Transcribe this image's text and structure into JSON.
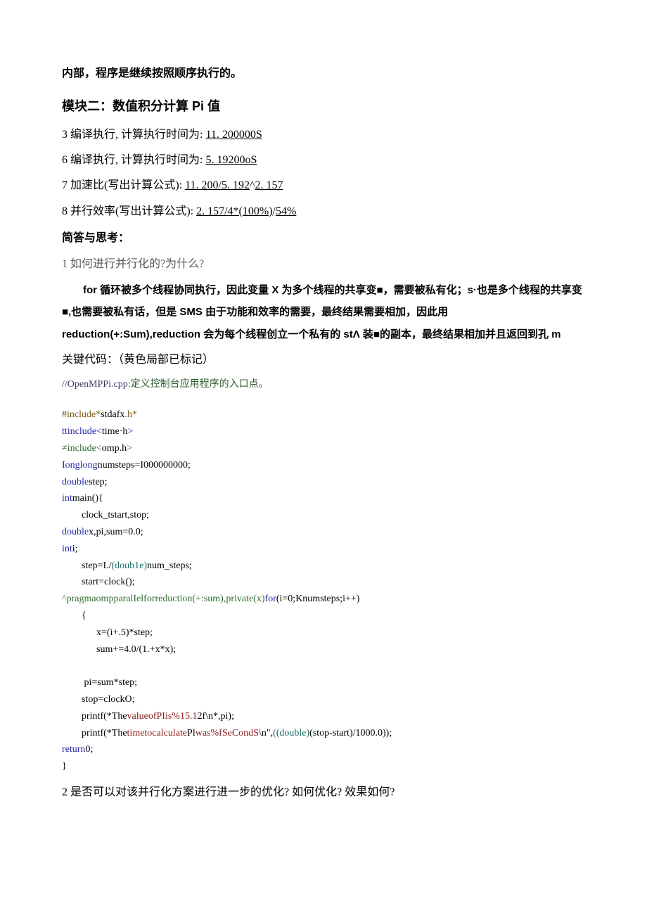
{
  "top_note": "内部，程序是继续按照顺序执行的。",
  "module_title": "模块二：数值积分计算 Pi 值",
  "line3_pre": "3 编译执行, 计算执行时间为: ",
  "line3_u": "11. 200000S",
  "line6_pre": "6 编译执行, 计算执行时间为: ",
  "line6_u": "5. 19200oS",
  "line7_pre": "7 加速比(写出计算公式): ",
  "line7_u1": "11. 200/5. 192",
  "line7_mid": "^",
  "line7_u2": "2. 157",
  "line8_pre": "8 并行效率(写出计算公式): ",
  "line8_u1": "2. 157/4*(100%)",
  "line8_mid": "/",
  "line8_u2": "54%",
  "qa_head": "简答与思考：",
  "q1": "1 如何进行并行化的?为什么?",
  "answer_parts": {
    "p1": "for 循环被多个线程协同执行，因此变量 X 为多个线程的共享变■，需要被私有化；s·也是多个线程的共享变■,也需要被私有话，但是 SMS 由于功能和效率的需要，最终结果需要相加，因此用 reduction(+:Sum),reduction 会为每个线程创立一个私有的 stΛ 装■的副本，最终结果相加并且返回到孔 m"
  },
  "keycode_label": "关键代码：（黄色局部已标记）",
  "comment_a": "//OpenMPPi.cpp:",
  "comment_b": "定义控制台应用程序的入口点。",
  "code": {
    "l1a": "#include*",
    "l1b": "stdafx",
    "l1c": ".h*",
    "l2a": "ttinclude<",
    "l2b": "time·h",
    "l2c": ">",
    "l3a": "≠include<",
    "l3b": "omp.h",
    "l3c": ">",
    "l4a": "Ionglong",
    "l4b": "numsteps=I000000000;",
    "l5a": "double",
    "l5b": "step;",
    "l6a": "int",
    "l6b": "main(){",
    "l7": "        clock_tstart,stop;",
    "l8a": "double",
    "l8b": "x,pi,sum=0.0;",
    "l9a": "int",
    "l9b": "i;",
    "l10a": "        step=I./",
    "l10b": "(doub1e)",
    "l10c": "num_steps;",
    "l11": "        start=clock();",
    "l12a": "^pragmaompparalIelforreduction(+:sum),private(x)",
    "l12b": "for",
    "l12c": "(i=0;Knumsteps;i++)",
    "l13": "        {",
    "l14": "              x=(i+.5)*step;",
    "l15": "              sum+=4.0/(1.+x*x);",
    "l16": "",
    "l17": "         pi=sum*step;",
    "l18": "        stop=clockO;",
    "l19a": "        printf(*The",
    "l19b": "valueofPIis%15.1",
    "l19c": "2f\\n*,pi);",
    "l20a": "        printf(*The",
    "l20b": "timetocalculate",
    "l20c": "Pl",
    "l20d": "was%fSeCondS",
    "l20e": "\\n\",",
    "l20f": "((double)",
    "l20g": "(stop-start)/1000.0));",
    "l21a": "return",
    "l21b": "0;",
    "l22": "}"
  },
  "q2": "2 是否可以对该并行化方案进行进一步的优化? 如何优化? 效果如何?"
}
